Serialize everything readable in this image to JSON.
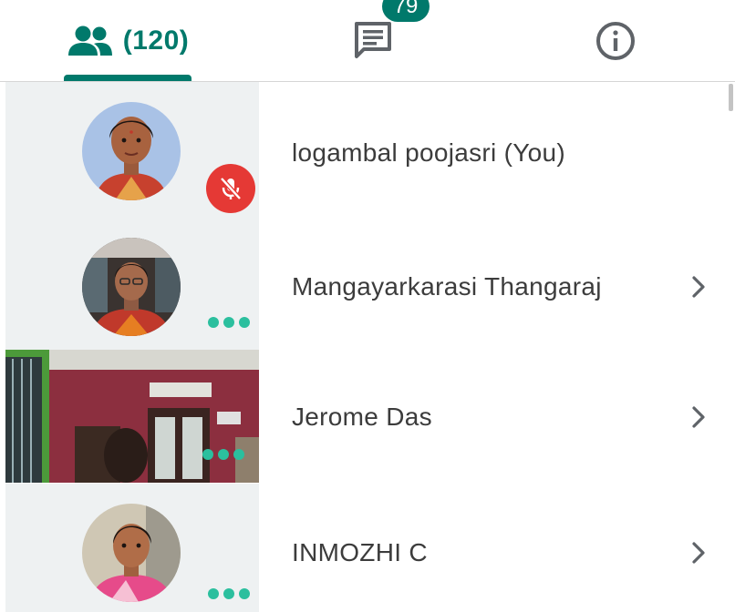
{
  "tabs": {
    "people": {
      "count_label": "(120)",
      "icon": "people-icon"
    },
    "chat": {
      "badge": "79",
      "icon": "chat-icon"
    },
    "info": {
      "icon": "info-icon"
    }
  },
  "participants": [
    {
      "name": "logambal poojasri (You)",
      "status": "muted",
      "icon": "mic-off-icon"
    },
    {
      "name": "Mangayarkarasi Thangaraj",
      "icon": "chevron-right-icon"
    },
    {
      "name": "Jerome Das",
      "icon": "chevron-right-icon"
    },
    {
      "name": "INMOZHI C",
      "icon": "chevron-right-icon"
    }
  ],
  "colors": {
    "accent": "#00796b",
    "mute": "#e53935",
    "dots": "#2bbf9e"
  }
}
